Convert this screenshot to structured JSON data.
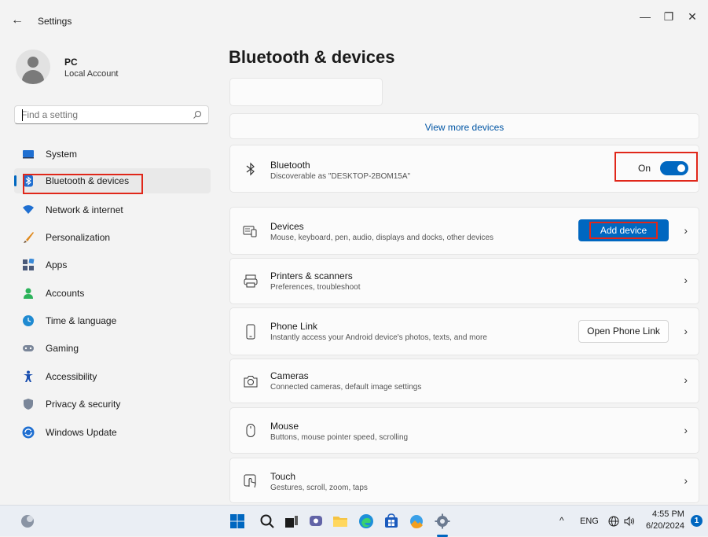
{
  "window": {
    "title": "Settings",
    "back_glyph": "←",
    "minimize_glyph": "—",
    "restore_glyph": "❐",
    "close_glyph": "✕"
  },
  "profile": {
    "name": "PC",
    "account_type": "Local Account"
  },
  "search": {
    "placeholder": "Find a setting",
    "icon": "search-icon"
  },
  "sidebar": {
    "items": [
      {
        "label": "System",
        "icon": "system-icon",
        "color": "#1f6fd1"
      },
      {
        "label": "Bluetooth & devices",
        "icon": "bluetooth-icon",
        "color": "#1f6fd1",
        "active": true
      },
      {
        "label": "Network & internet",
        "icon": "wifi-icon",
        "color": "#1f6fd1"
      },
      {
        "label": "Personalization",
        "icon": "brush-icon",
        "color": "#e08a1e"
      },
      {
        "label": "Apps",
        "icon": "apps-icon",
        "color": "#4a5a7a"
      },
      {
        "label": "Accounts",
        "icon": "accounts-icon",
        "color": "#2bb35a"
      },
      {
        "label": "Time & language",
        "icon": "globe-clock-icon",
        "color": "#1f8ad1"
      },
      {
        "label": "Gaming",
        "icon": "gamepad-icon",
        "color": "#7a8699"
      },
      {
        "label": "Accessibility",
        "icon": "accessibility-icon",
        "color": "#1a4fb0"
      },
      {
        "label": "Privacy & security",
        "icon": "shield-icon",
        "color": "#7a8699"
      },
      {
        "label": "Windows Update",
        "icon": "update-icon",
        "color": "#1f6fd1"
      }
    ]
  },
  "main": {
    "title": "Bluetooth & devices",
    "view_more": "View more devices",
    "bluetooth": {
      "title": "Bluetooth",
      "subtitle": "Discoverable as \"DESKTOP-2BOM15A\"",
      "state_label": "On",
      "enabled": true
    },
    "rows": [
      {
        "title": "Devices",
        "subtitle": "Mouse, keyboard, pen, audio, displays and docks, other devices",
        "icon": "keyboard-device-icon",
        "button": "Add device"
      },
      {
        "title": "Printers & scanners",
        "subtitle": "Preferences, troubleshoot",
        "icon": "printer-icon"
      },
      {
        "title": "Phone Link",
        "subtitle": "Instantly access your Android device's photos, texts, and more",
        "icon": "phone-icon",
        "button": "Open Phone Link"
      },
      {
        "title": "Cameras",
        "subtitle": "Connected cameras, default image settings",
        "icon": "camera-icon"
      },
      {
        "title": "Mouse",
        "subtitle": "Buttons, mouse pointer speed, scrolling",
        "icon": "mouse-icon"
      },
      {
        "title": "Touch",
        "subtitle": "Gestures, scroll, zoom, taps",
        "icon": "touch-icon"
      }
    ],
    "chevron": "›"
  },
  "taskbar": {
    "language": "ENG",
    "time": "4:55 PM",
    "date": "6/20/2024",
    "notification_count": "1",
    "tray_up_glyph": "^"
  },
  "colors": {
    "accent": "#0067c0",
    "highlight": "#e0271a"
  }
}
